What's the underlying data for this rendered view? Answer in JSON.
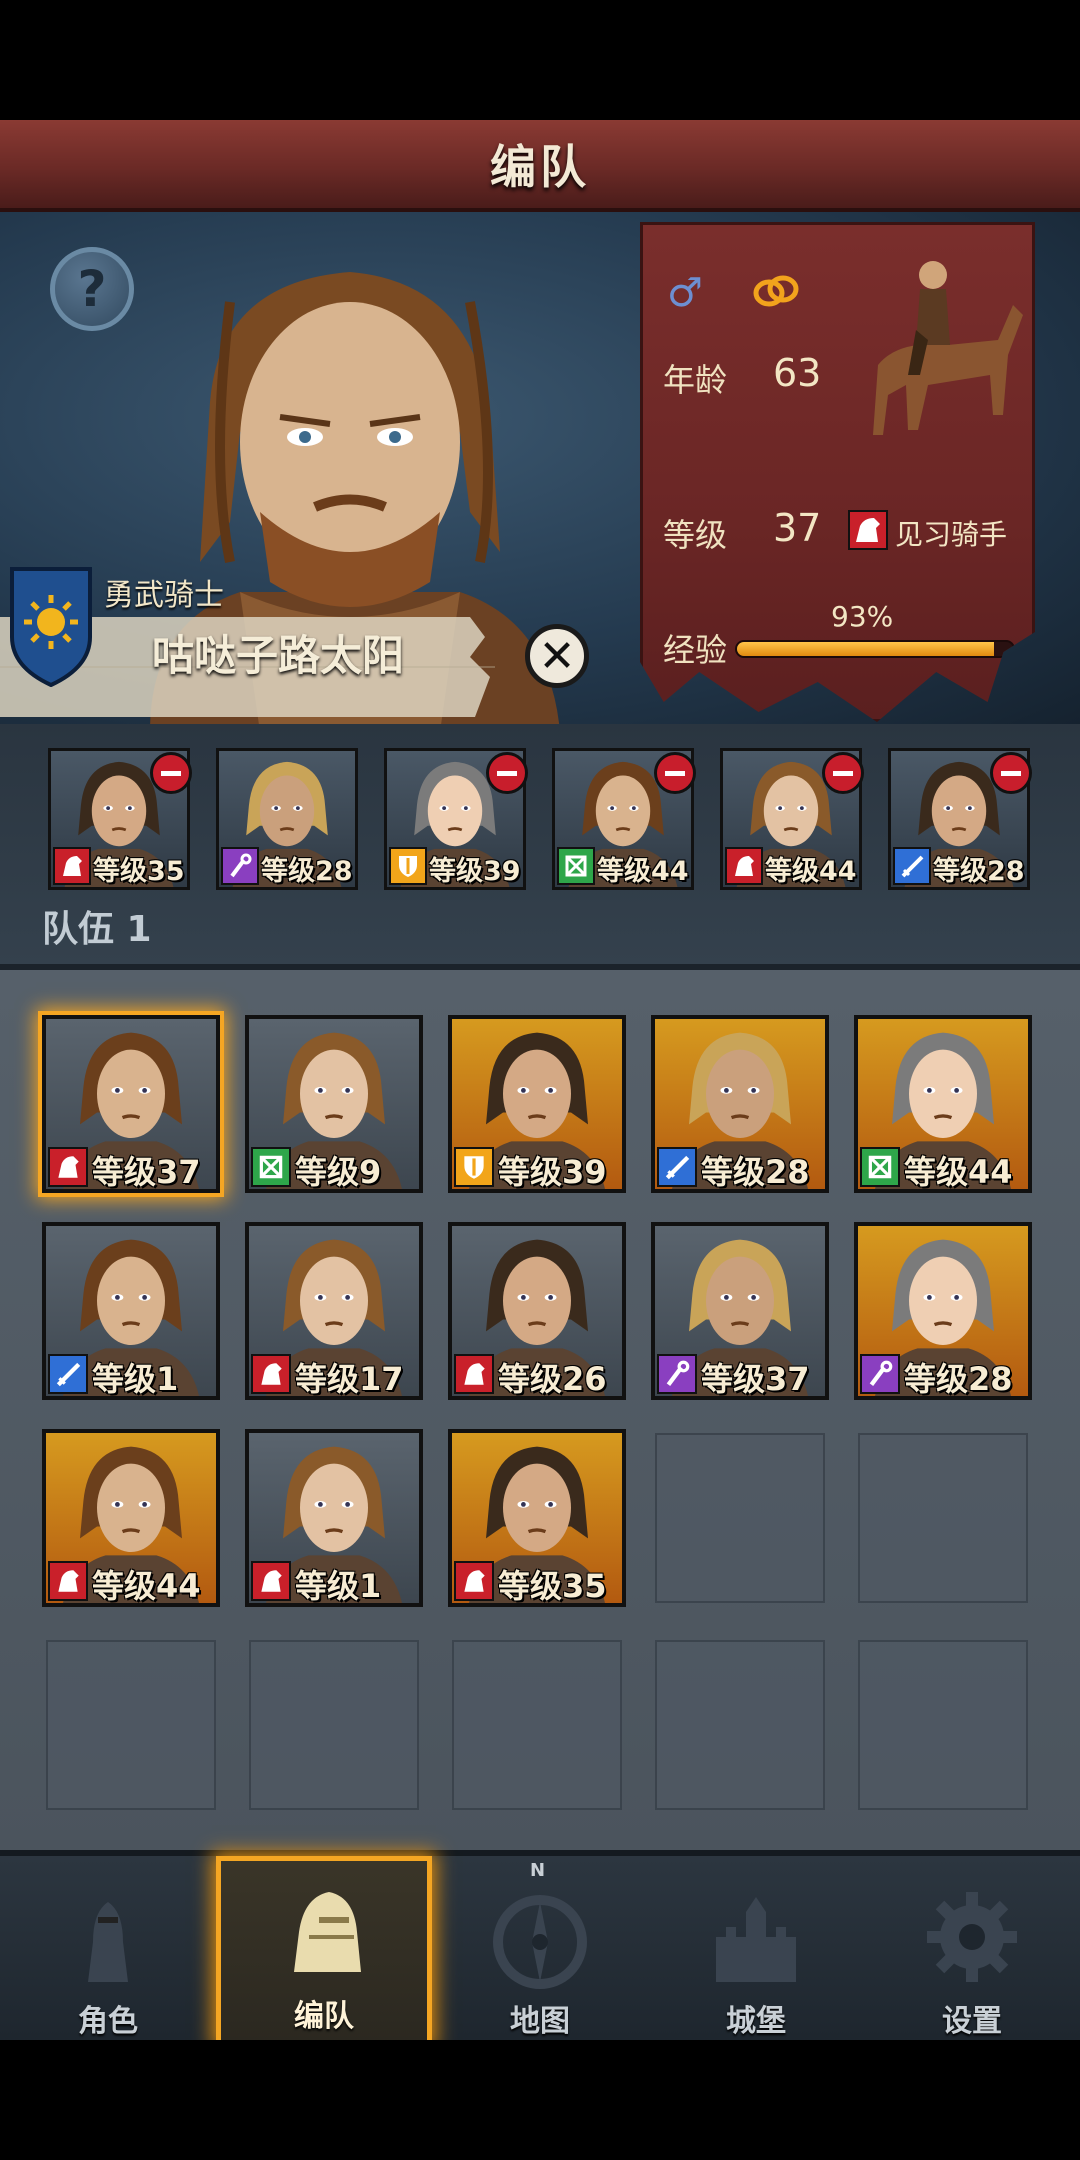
{
  "header": {
    "title": "编队"
  },
  "hero": {
    "rank": "勇武骑士",
    "name": "咕哒子路太阳",
    "help_symbol": "?",
    "close_symbol": "✕",
    "gender_symbol": "♂",
    "stats": {
      "age_label": "年龄",
      "age_value": "63",
      "level_label": "等级",
      "level_value": "37",
      "class_name": "见习骑手",
      "exp_label": "经验",
      "exp_percent_text": "93%",
      "exp_fraction": 0.93
    }
  },
  "team": {
    "label": "队伍 1",
    "members": [
      {
        "level_text": "等级35",
        "class": "horse",
        "bg": "#3a4552"
      },
      {
        "level_text": "等级28",
        "class": "staff",
        "bg": "#3a4552"
      },
      {
        "level_text": "等级39",
        "class": "shield",
        "bg": "#3a4552"
      },
      {
        "level_text": "等级44",
        "class": "bow",
        "bg": "#3a4552"
      },
      {
        "level_text": "等级44",
        "class": "horse",
        "bg": "#3a4552"
      },
      {
        "level_text": "等级28",
        "class": "sword",
        "bg": "#3a4552"
      }
    ]
  },
  "roster": {
    "cards": [
      {
        "level_text": "等级37",
        "class": "horse",
        "bg": "gray",
        "selected": true
      },
      {
        "level_text": "等级9",
        "class": "bow",
        "bg": "gray"
      },
      {
        "level_text": "等级39",
        "class": "shield",
        "bg": "orange"
      },
      {
        "level_text": "等级28",
        "class": "sword",
        "bg": "orange"
      },
      {
        "level_text": "等级44",
        "class": "bow",
        "bg": "orange"
      },
      {
        "level_text": "等级1",
        "class": "sword",
        "bg": "gray"
      },
      {
        "level_text": "等级17",
        "class": "horse",
        "bg": "gray"
      },
      {
        "level_text": "等级26",
        "class": "horse",
        "bg": "gray"
      },
      {
        "level_text": "等级37",
        "class": "staff",
        "bg": "gray"
      },
      {
        "level_text": "等级28",
        "class": "staff",
        "bg": "orange"
      },
      {
        "level_text": "等级44",
        "class": "horse",
        "bg": "orange"
      },
      {
        "level_text": "等级1",
        "class": "horse",
        "bg": "gray"
      },
      {
        "level_text": "等级35",
        "class": "horse",
        "bg": "orange"
      }
    ]
  },
  "nav": {
    "items": [
      {
        "label": "角色",
        "icon": "knight-icon"
      },
      {
        "label": "编队",
        "icon": "helmet-icon",
        "active": true
      },
      {
        "label": "地图",
        "icon": "compass-icon"
      },
      {
        "label": "城堡",
        "icon": "castle-icon"
      },
      {
        "label": "设置",
        "icon": "gear-icon"
      }
    ],
    "compass_letter": "N"
  },
  "colors": {
    "accent": "#f5a623",
    "title_bar": "#6b2a26",
    "stats_panel": "#6a2625",
    "horse_class": "#c9202a",
    "staff_class": "#8a3fc0",
    "shield_class": "#f2a51a",
    "bow_class": "#2ea64a",
    "sword_class": "#2f6fd6"
  }
}
